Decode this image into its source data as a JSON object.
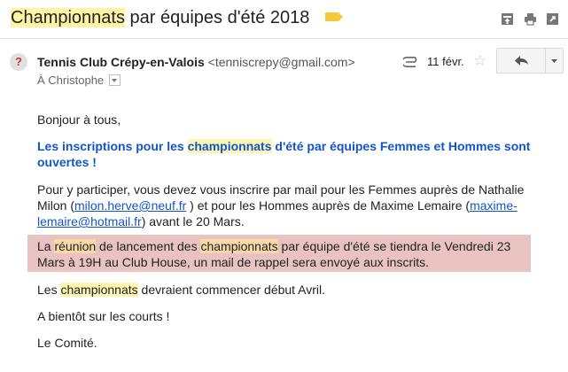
{
  "subject": {
    "part1": "Championnats",
    "part2": " par équipes d'été 2018"
  },
  "toolbar": {
    "icons": [
      "archive-icon",
      "print-icon",
      "new-window-icon"
    ]
  },
  "message": {
    "avatar_char": "?",
    "sender_name": "Tennis Club Crépy-en-Valois",
    "sender_email": "<tenniscrepy@gmail.com>",
    "date": "11 févr.",
    "recipient": "À Christophe"
  },
  "body": {
    "greeting": "Bonjour à tous,",
    "announce": {
      "a": "Les inscriptions pour les ",
      "b": "championnats",
      "c": " d'été par équipes Femmes et Hommes sont ouvertes !"
    },
    "instructions": {
      "a": "Pour y participer, vous devez vous inscrire par mail pour les Femmes auprès de Nathalie Milon (",
      "link1": "milon.herve@neuf.fr",
      "b": " ) et pour les Hommes auprès de Maxime Lemaire (",
      "link2": "maxime-lemaire@hotmail.fr",
      "c": ") avant le 20 Mars."
    },
    "meeting": {
      "a": "La ",
      "b": "réunion",
      "c": " de lancement des ",
      "d": "championnats",
      "e": " par équipe d'été se tiendra le Vendredi 23 Mars à 19H au Club House, un mail de rappel sera envoyé aux inscrits."
    },
    "start": {
      "a": "Les ",
      "b": "championnats",
      "c": " devraient commencer début Avril."
    },
    "soon": "A bientôt sur les courts  !",
    "signature": "Le Comité."
  },
  "colors": {
    "link": "#1155cc",
    "search_highlight": "#fdf6b3",
    "block_highlight": "#e9c2c2",
    "label_tag": "#f6c93a"
  }
}
